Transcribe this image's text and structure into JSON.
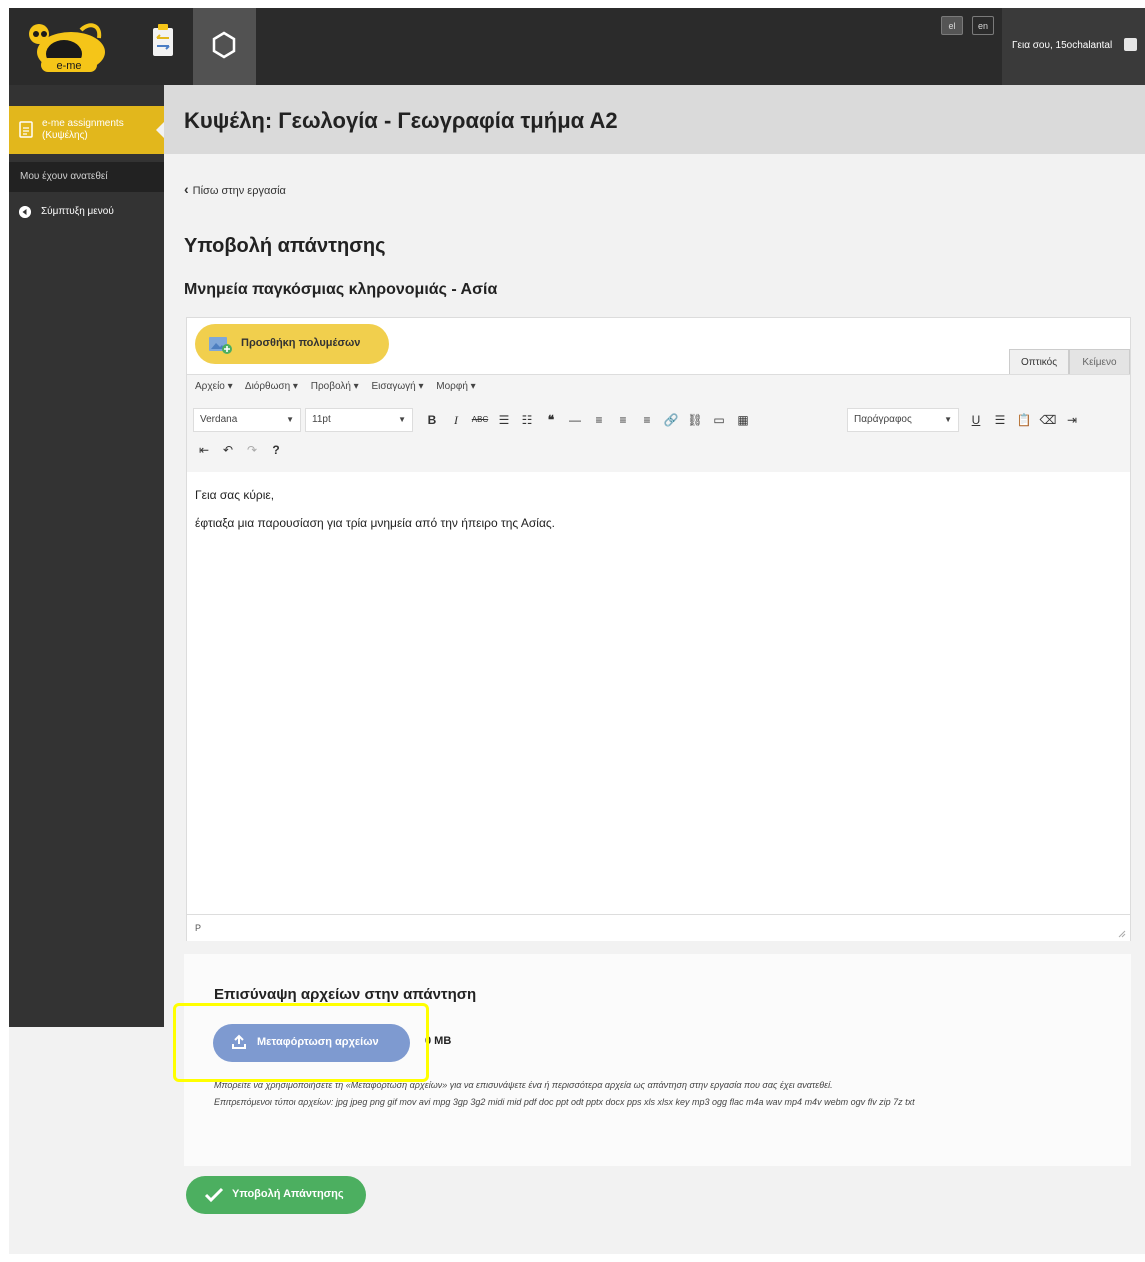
{
  "header": {
    "logo_text": "e-me",
    "lang_el": "el",
    "lang_en": "en",
    "greeting": "Γεια σου, 15ochalantal"
  },
  "sidebar": {
    "active_item": "e-me assignments (Κυψέλης)",
    "assigned_item": "Μου έχουν ανατεθεί",
    "collapse_item": "Σύμπτυξη μενού"
  },
  "main": {
    "title": "Κυψέλη: Γεωλογία - Γεωγραφία τμήμα Α2",
    "back_link": "Πίσω στην εργασία",
    "submit_heading": "Υποβολή απάντησης",
    "assignment_title": "Μνημεία παγκόσμιας κληρονομιάς - Ασία"
  },
  "editor": {
    "media_button": "Προσθήκη πολυμέσων",
    "tab_visual": "Οπτικός",
    "tab_text": "Κείμενο",
    "menus": [
      "Αρχείο ▾",
      "Διόρθωση ▾",
      "Προβολή ▾",
      "Εισαγωγή ▾",
      "Μορφή ▾"
    ],
    "font": "Verdana",
    "font_size": "11pt",
    "paragraph": "Παράγραφος",
    "content_line1": "Γεια σας κύριε,",
    "content_line2": "έφτιαξα μια παρουσίαση για τρία μνημεία από την ήπειρο της Ασίας.",
    "status_path": "P"
  },
  "attachments": {
    "heading": "Επισύναψη αρχείων στην απάντηση",
    "upload_button": "Μεταφόρτωση αρχείων",
    "size": "0 MB",
    "help_text": "Μπορείτε να χρησιμοποιήσετε τη «Μεταφόρτωση αρχείων» για να επισυνάψετε ένα ή περισσότερα αρχεία ως απάντηση στην εργασία που σας έχει ανατεθεί.",
    "allowed_types": "Επιτρεπόμενοι τύποι αρχείων: jpg jpeg png gif mov avi mpg 3gp 3g2 midi mid pdf doc ppt odt pptx docx pps xls xlsx key mp3 ogg flac m4a wav mp4 m4v webm ogv flv zip 7z txt"
  },
  "submit_button": "Υποβολή Απάντησης",
  "colors": {
    "brand_yellow": "#e2b71c",
    "upload_blue": "#7e9ad0",
    "submit_green": "#4caf60",
    "highlight": "#ffff00"
  }
}
